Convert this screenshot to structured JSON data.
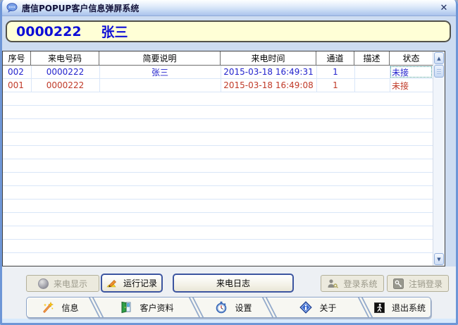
{
  "window": {
    "title": "唐信POPUP客户信息弹屏系统"
  },
  "icons": {
    "close": "✕",
    "scroll_up": "▲",
    "scroll_down": "▼"
  },
  "banner": {
    "number": "0000222",
    "name": "张三"
  },
  "table": {
    "columns": [
      "序号",
      "来电号码",
      "简要说明",
      "来电时间",
      "通道",
      "描述",
      "状态"
    ],
    "rows": [
      {
        "seq": "002",
        "number": "0000222",
        "note": "张三",
        "time": "2015-03-18 16:49:31",
        "channel": "1",
        "memo": "",
        "status": "未接"
      },
      {
        "seq": "001",
        "number": "0000222",
        "note": "",
        "time": "2015-03-18 16:49:08",
        "channel": "1",
        "memo": "",
        "status": "未接"
      }
    ]
  },
  "buttons": {
    "caller_display": "来电显示",
    "run_log": "运行记录",
    "call_log": "来电日志",
    "login": "登录系统",
    "logout": "注销登录"
  },
  "tabs": [
    {
      "label": "信息"
    },
    {
      "label": "客户资料"
    },
    {
      "label": "设置"
    },
    {
      "label": "关于"
    },
    {
      "label": "退出系统"
    }
  ],
  "colors": {
    "row_new": "#2323cd",
    "row_missed": "#c03a28",
    "banner_bg": "#ffffd6",
    "banner_text": "#0d0dd6",
    "window_border": "#6e96d6"
  }
}
